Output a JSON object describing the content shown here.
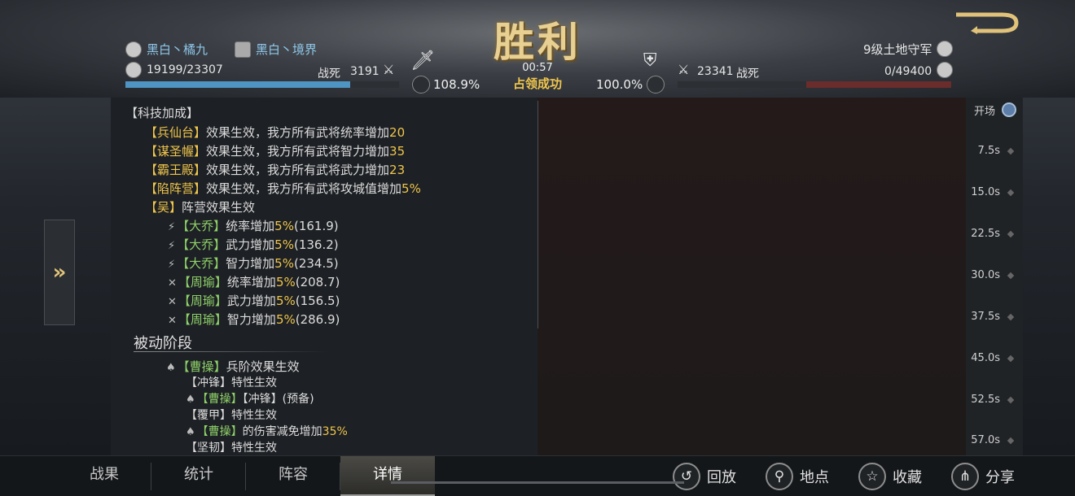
{
  "header": {
    "result_title": "胜利",
    "left": {
      "player_name": "黑白丶橘九",
      "alliance_name": "黑白丶境界",
      "troops": "19199/23307",
      "dead_label": "战死",
      "dead_value": "3191",
      "troop_fraction": 0.82
    },
    "right": {
      "player_name": "9级土地守军",
      "troops": "0/49400",
      "dead_value": "23341",
      "dead_label": "战死",
      "troop_fraction": 0.53
    },
    "time": "00:57",
    "status": "占领成功",
    "left_pct": "108.9%",
    "right_pct": "100.0%"
  },
  "log": {
    "tech_header": "【科技加成】",
    "tech_lines": [
      {
        "name": "【兵仙台】",
        "text": "效果生效，我方所有武将统率增加",
        "value": "20"
      },
      {
        "name": "【谋圣幄】",
        "text": "效果生效，我方所有武将智力增加",
        "value": "35"
      },
      {
        "name": "【霸王殿】",
        "text": "效果生效，我方所有武将武力增加",
        "value": "23"
      },
      {
        "name": "【陷阵营】",
        "text": "效果生效，我方所有武将攻城值增加",
        "value": "5%"
      }
    ],
    "camp_name": "【吴】",
    "camp_text": "阵营效果生效",
    "camp_lines": [
      {
        "hero": "【大乔】",
        "text": "统率增加",
        "pct": "5%",
        "val": "(161.9)"
      },
      {
        "hero": "【大乔】",
        "text": "武力增加",
        "pct": "5%",
        "val": "(136.2)"
      },
      {
        "hero": "【大乔】",
        "text": "智力增加",
        "pct": "5%",
        "val": "(234.5)"
      },
      {
        "hero": "【周瑜】",
        "text": "统率增加",
        "pct": "5%",
        "val": "(208.7)"
      },
      {
        "hero": "【周瑜】",
        "text": "武力增加",
        "pct": "5%",
        "val": "(156.5)"
      },
      {
        "hero": "【周瑜】",
        "text": "智力增加",
        "pct": "5%",
        "val": "(286.9)"
      }
    ],
    "passive_title": "被动阶段",
    "passive": {
      "hero1": "【曹操】",
      "hero1_text": "兵阶效果生效",
      "trait1": "【冲锋】",
      "trait1_text": "特性生效",
      "hero2": "【曹操】",
      "hero2_text": "【冲锋】(预备)",
      "trait2": "【覆甲】",
      "trait2_text": "特性生效",
      "hero3": "【曹操】",
      "hero3_text": "的伤害减免增加",
      "hero3_pct": "35%",
      "trait3": "【坚韧】",
      "trait3_text": "特性生效"
    }
  },
  "timeline": [
    "开场",
    "7.5s",
    "15.0s",
    "22.5s",
    "30.0s",
    "37.5s",
    "45.0s",
    "52.5s",
    "57.0s"
  ],
  "tabs": [
    "战果",
    "统计",
    "阵容",
    "详情"
  ],
  "actions": [
    "回放",
    "地点",
    "收藏",
    "分享"
  ],
  "colors": {
    "accent_gold": "#f0c64d",
    "hero_green": "#8fd16a",
    "ally_blue": "#4f95c4",
    "enemy_red": "#e0685b"
  }
}
